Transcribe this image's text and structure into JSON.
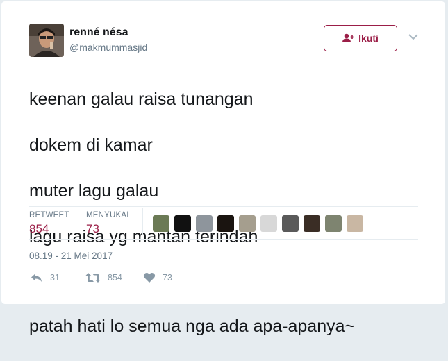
{
  "user": {
    "name": "renné nésa",
    "handle": "@makmummasjid"
  },
  "follow_button": {
    "label": "Ikuti",
    "icon": "add-user-icon",
    "color": "#9b1e47"
  },
  "more_icon": "chevron-down-icon",
  "tweet": {
    "lines": [
      "keenan galau raisa tunangan",
      "dokem di kamar",
      "muter lagu galau",
      "lagu raisa yg mantan terindah",
      "patah hati lo semua nga ada apa-apanya~"
    ]
  },
  "stats": {
    "retweet_label": "RETWEET",
    "retweet_count": "854",
    "likes_label": "MENYUKAI",
    "likes_count": "73"
  },
  "likers": [
    {
      "avatar_color": "#6b7a55"
    },
    {
      "avatar_color": "#111111"
    },
    {
      "avatar_color": "#8e959c"
    },
    {
      "avatar_color": "#1a1410"
    },
    {
      "avatar_color": "#a59e8e"
    },
    {
      "avatar_color": "#d8d8d8"
    },
    {
      "avatar_color": "#5a5a5a"
    },
    {
      "avatar_color": "#3a2d25"
    },
    {
      "avatar_color": "#7e8470"
    },
    {
      "avatar_color": "#c9b7a3"
    }
  ],
  "timestamp": "08.19 - 21 Mei 2017",
  "actions": {
    "reply": {
      "icon": "reply-icon",
      "count": "31"
    },
    "retweet": {
      "icon": "retweet-icon",
      "count": "854"
    },
    "like": {
      "icon": "heart-icon",
      "count": "73"
    }
  }
}
